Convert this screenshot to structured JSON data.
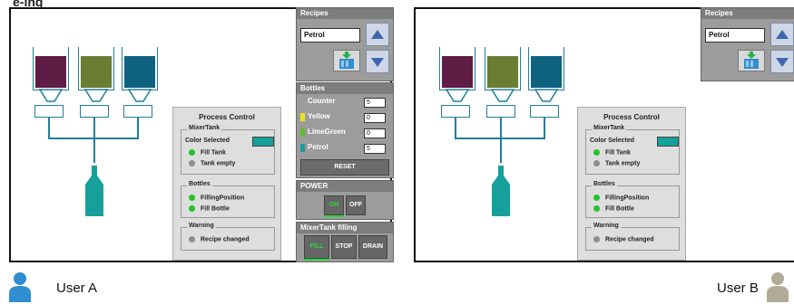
{
  "page_title": "e-ing",
  "left": {
    "user_label": "User A",
    "recipes": {
      "header": "Recipes",
      "value": "Petrol"
    },
    "bottles": {
      "header": "Bottles",
      "counter_label": "Counter",
      "counter_value": "5",
      "yellow_label": "Yellow",
      "yellow_value": "0",
      "limegreen_label": "LimeGreen",
      "limegreen_value": "0",
      "petrol_label": "Petrol",
      "petrol_value": "5",
      "reset_label": "RESET"
    },
    "power": {
      "header": "POWER",
      "on_label": "ON",
      "off_label": "OFF"
    },
    "mixer": {
      "header": "MixerTank filling",
      "fill_label": "FILL",
      "stop_label": "STOP",
      "drain_label": "DRAIN"
    }
  },
  "right": {
    "user_label": "User B",
    "recipes": {
      "header": "Recipes",
      "value": "Petrol"
    }
  },
  "process_control": {
    "title": "Process Control",
    "mixer_group": "MixerTank",
    "color_selected": "Color Selected",
    "fill_tank": "Fill Tank",
    "tank_empty": "Tank empty",
    "bottles_group": "Bottles",
    "filling_position": "FillingPosition",
    "fill_bottle": "Fill Bottle",
    "warning_group": "Warning",
    "recipe_changed": "Recipe changed"
  },
  "colors": {
    "tank_purple": "#5f1d45",
    "tank_green": "#6a7d33",
    "tank_blue": "#0f6280",
    "teal": "#16a09c",
    "led_green": "#22c42a",
    "led_gray": "#8e8e8e",
    "yellow": "#f2e21a",
    "lime": "#5bbd2a",
    "petrol": "#1a9da0"
  }
}
